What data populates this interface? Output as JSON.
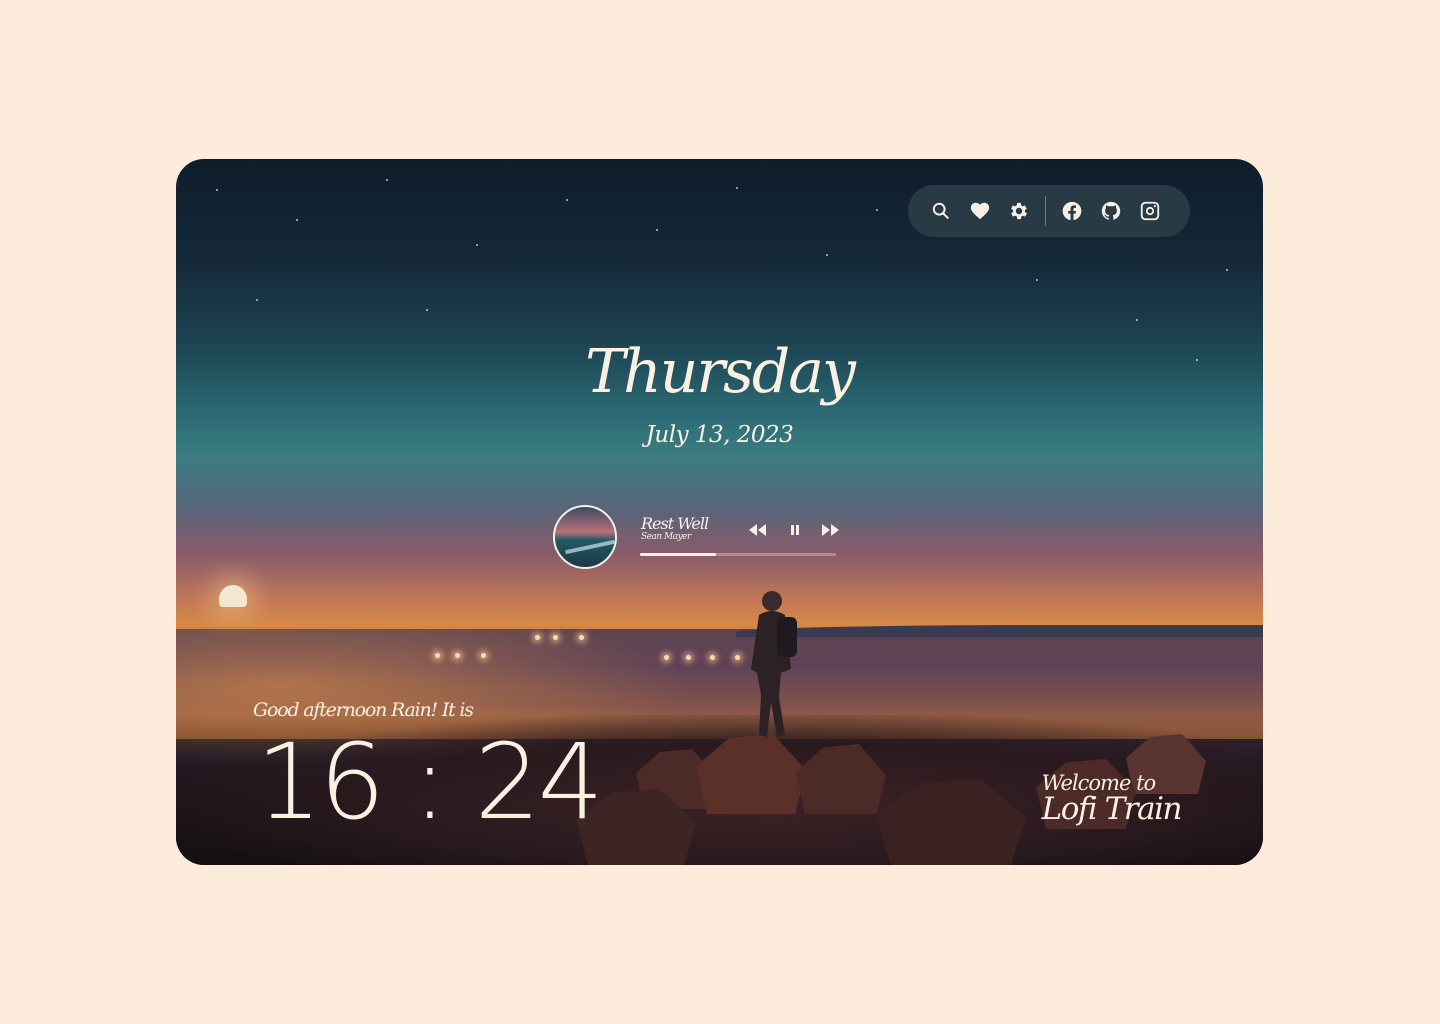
{
  "toolbar": {
    "icons": [
      "search-icon",
      "heart-icon",
      "gear-icon",
      "facebook-icon",
      "github-icon",
      "instagram-icon"
    ]
  },
  "header": {
    "day": "Thursday",
    "date": "July 13, 2023"
  },
  "player": {
    "title": "Rest Well",
    "artist": "Sean Mayer",
    "progress": 0.39,
    "controls": [
      "rewind-icon",
      "pause-icon",
      "fast-forward-icon"
    ]
  },
  "greeting": {
    "text": "Good afternoon Rain! It is",
    "time": "16 : 24"
  },
  "welcome": {
    "line1": "Welcome to",
    "line2": "Lofi Train"
  },
  "colors": {
    "page_background": "#fdebdb",
    "text": "#fbf1e3",
    "toolbar_background": "#2d3e46"
  }
}
